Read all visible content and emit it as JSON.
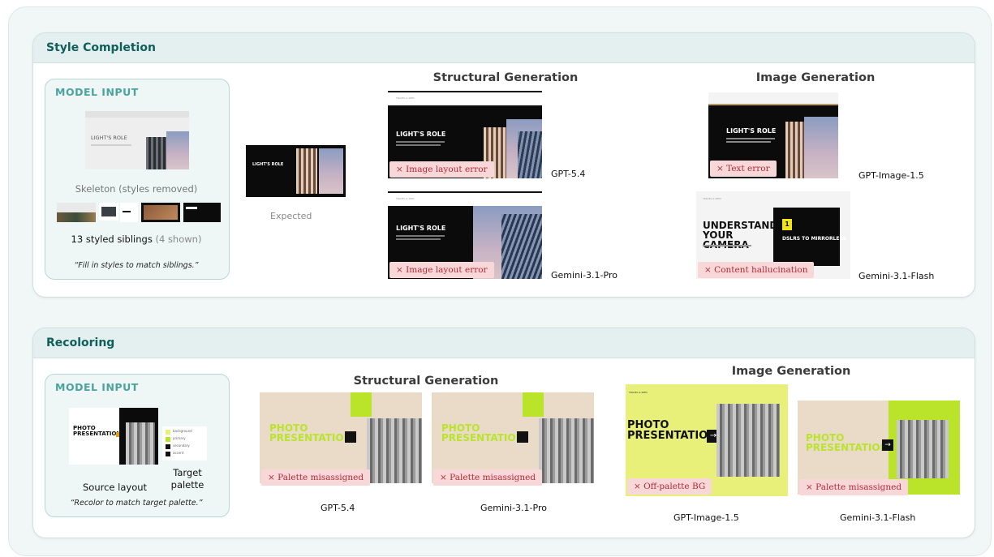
{
  "style_completion": {
    "header": "Style Completion",
    "input": {
      "title": "MODEL INPUT",
      "skeleton_caption": "Skeleton (styles removed)",
      "skeleton_text": "LIGHT'S ROLE",
      "siblings_count": "13 styled siblings",
      "siblings_shown": "(4 shown)",
      "instruction": "“Fill in styles to match siblings.”"
    },
    "expected_caption": "Expected",
    "structural_title": "Structural Generation",
    "image_title": "Image Generation",
    "results": [
      {
        "model": "GPT-5.4",
        "error": "Image layout error",
        "slide_title": "LIGHT'S ROLE"
      },
      {
        "model": "Gemini-3.1-Pro",
        "error": "Image layout error",
        "slide_title": "LIGHT'S ROLE"
      },
      {
        "model": "GPT-Image-1.5",
        "error": "Text error",
        "slide_title": "LIGHT'S ROLE"
      },
      {
        "model": "Gemini-3.1-Flash",
        "error": "Content hallucination",
        "slide_title": "UNDERSTAND YOUR CAMERA",
        "slide_number": "1",
        "slide_sub": "DSLRS TO MIRRORLESS"
      }
    ]
  },
  "recoloring": {
    "header": "Recoloring",
    "input": {
      "title": "MODEL INPUT",
      "source_caption": "Source layout",
      "palette_caption": "Target palette",
      "source_text": "PHOTO PRESENTATION",
      "palette_items": [
        "background",
        "primary",
        "secondary",
        "accent"
      ],
      "palette_colors": [
        "#e8f07a",
        "#b9e42a",
        "#111111",
        "#111111"
      ],
      "instruction": "“Recolor to match target palette.”"
    },
    "structural_title": "Structural Generation",
    "image_title": "Image Generation",
    "results": [
      {
        "model": "GPT-5.4",
        "error": "Palette misassigned",
        "slide_title": "PHOTO PRESENTATION"
      },
      {
        "model": "Gemini-3.1-Pro",
        "error": "Palette misassigned",
        "slide_title": "PHOTO PRESENTATION"
      },
      {
        "model": "GPT-Image-1.5",
        "error": "Off-palette BG",
        "slide_title": "PHOTO PRESENTATION"
      },
      {
        "model": "Gemini-3.1-Flash",
        "error": "Palette misassigned",
        "slide_title": "PHOTO PRESENTATION"
      }
    ]
  },
  "icons": {
    "error_mark": "×",
    "arrow": "→"
  },
  "colors": {
    "teal": "#0f5e5a",
    "error_bg": "#f8d7d9",
    "error_text": "#b02b35",
    "lime": "#b9e42a",
    "yellow": "#e8f07a",
    "beige": "#eadbc9"
  }
}
